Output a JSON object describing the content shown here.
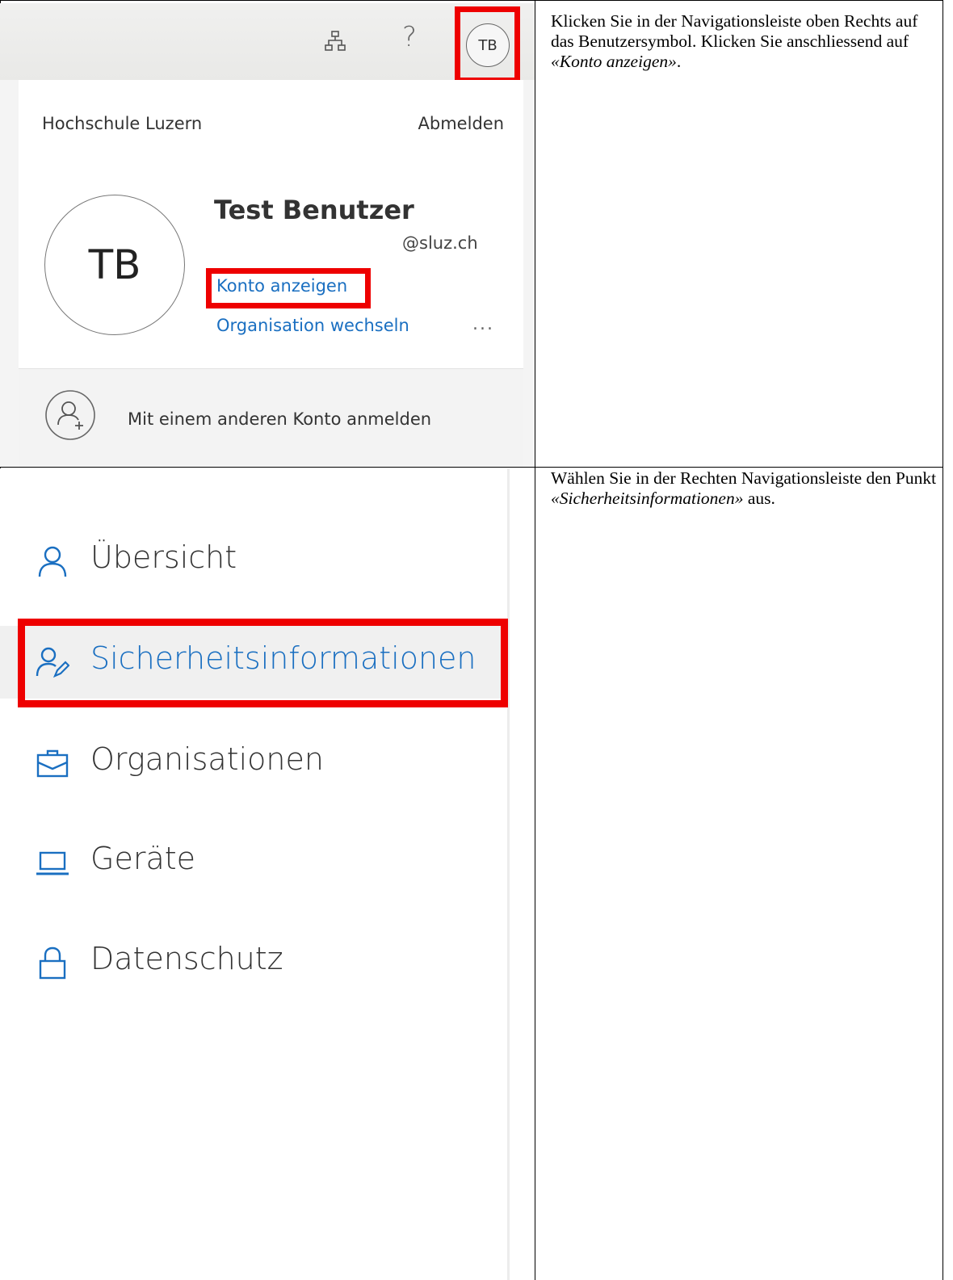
{
  "accent_color": "#1a6fc1",
  "highlight_color": "#ee0000",
  "step1": {
    "text_before": "Klicken Sie in der Navigationsleiste oben Rechts auf das Benutzersymbol. Klicken Sie anschliessend auf ",
    "text_emph": "«Konto anzeigen»",
    "text_after": "."
  },
  "step2": {
    "text_before": "Wählen Sie in der Rechten Navigationsleiste den Punkt ",
    "text_emph": "«Sicherheitsinformationen»",
    "text_after": " aus."
  },
  "account_menu": {
    "help_glyph": "?",
    "avatar_initials": "TB",
    "organization": "Hochschule Luzern",
    "sign_out": "Abmelden",
    "user_name": "Test Benutzer",
    "user_email": "@sluz.ch",
    "view_account": "Konto anzeigen",
    "switch_org": "Organisation wechseln",
    "more": "...",
    "other_account": "Mit einem anderen Konto anmelden",
    "icons": [
      "org-chart-icon",
      "help-icon",
      "add-user-icon"
    ]
  },
  "sidebar": {
    "items": [
      {
        "label": "Übersicht",
        "icon": "person-icon",
        "active": false
      },
      {
        "label": "Sicherheitsinformationen",
        "icon": "person-key-icon",
        "active": true
      },
      {
        "label": "Organisationen",
        "icon": "briefcase-icon",
        "active": false
      },
      {
        "label": "Geräte",
        "icon": "laptop-icon",
        "active": false
      },
      {
        "label": "Datenschutz",
        "icon": "lock-icon",
        "active": false
      }
    ]
  }
}
